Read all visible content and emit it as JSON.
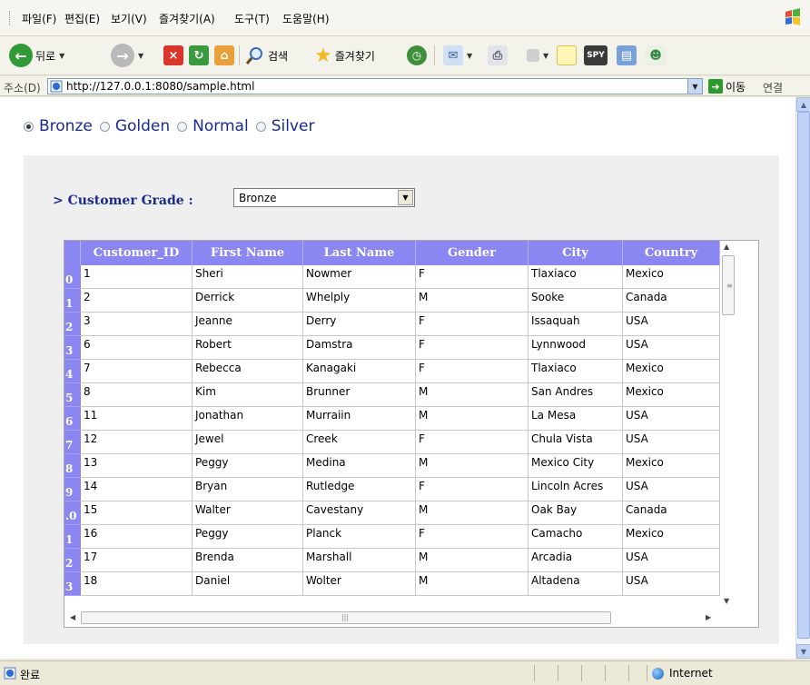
{
  "menu": {
    "items": [
      "파일(F)",
      "편집(E)",
      "보기(V)",
      "즐겨찾기(A)",
      "도구(T)",
      "도움말(H)"
    ]
  },
  "toolbar": {
    "back_label": "뒤로",
    "search_label": "검색",
    "favorites_label": "즐겨찾기"
  },
  "address": {
    "label": "주소(D)",
    "url": "http://127.0.0.1:8080/sample.html",
    "go_label": "이동",
    "links_label": "연결"
  },
  "page": {
    "radios": [
      {
        "label": "Bronze",
        "checked": true
      },
      {
        "label": "Golden",
        "checked": false
      },
      {
        "label": "Normal",
        "checked": false
      },
      {
        "label": "Silver",
        "checked": false
      }
    ],
    "grade_label": "> Customer Grade :",
    "grade_value": "Bronze"
  },
  "grid": {
    "columns": [
      "Customer_ID",
      "First Name",
      "Last Name",
      "Gender",
      "City",
      "Country"
    ],
    "row_numbers": [
      "0",
      "1",
      "2",
      "3",
      "4",
      "5",
      "6",
      "7",
      "8",
      "9",
      ".0",
      "1",
      "2",
      "3"
    ],
    "rows": [
      [
        "1",
        "Sheri",
        "Nowmer",
        "F",
        "Tlaxiaco",
        "Mexico"
      ],
      [
        "2",
        "Derrick",
        "Whelply",
        "M",
        "Sooke",
        "Canada"
      ],
      [
        "3",
        "Jeanne",
        "Derry",
        "F",
        "Issaquah",
        "USA"
      ],
      [
        "6",
        "Robert",
        "Damstra",
        "F",
        "Lynnwood",
        "USA"
      ],
      [
        "7",
        "Rebecca",
        "Kanagaki",
        "F",
        "Tlaxiaco",
        "Mexico"
      ],
      [
        "8",
        "Kim",
        "Brunner",
        "M",
        "San Andres",
        "Mexico"
      ],
      [
        "11",
        "Jonathan",
        "Murraiin",
        "M",
        "La Mesa",
        "USA"
      ],
      [
        "12",
        "Jewel",
        "Creek",
        "F",
        "Chula Vista",
        "USA"
      ],
      [
        "13",
        "Peggy",
        "Medina",
        "M",
        "Mexico City",
        "Mexico"
      ],
      [
        "14",
        "Bryan",
        "Rutledge",
        "F",
        "Lincoln Acres",
        "USA"
      ],
      [
        "15",
        "Walter",
        "Cavestany",
        "M",
        "Oak Bay",
        "Canada"
      ],
      [
        "16",
        "Peggy",
        "Planck",
        "F",
        "Camacho",
        "Mexico"
      ],
      [
        "17",
        "Brenda",
        "Marshall",
        "M",
        "Arcadia",
        "USA"
      ],
      [
        "18",
        "Daniel",
        "Wolter",
        "M",
        "Altadena",
        "USA"
      ]
    ]
  },
  "status": {
    "text": "완료",
    "zone": "Internet"
  }
}
